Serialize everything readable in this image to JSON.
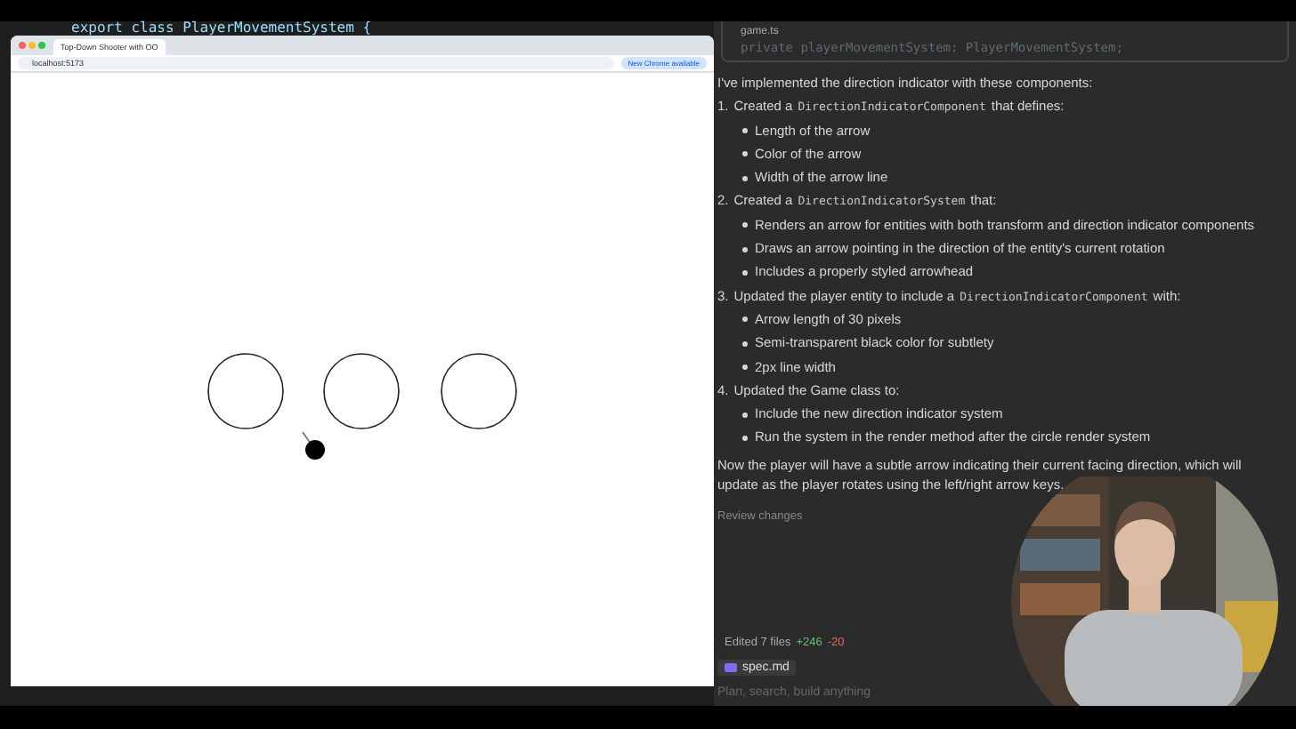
{
  "editor": {
    "code_line": "export class PlayerMovementSystem {"
  },
  "browser": {
    "tab_title": "Top-Down Shooter with OO",
    "address": "localhost:5173",
    "update_button": "New Chrome available",
    "scene": [
      {
        "kind": "ring"
      },
      {
        "kind": "ring"
      },
      {
        "kind": "ring"
      },
      {
        "kind": "player"
      }
    ]
  },
  "chat": {
    "file_tab": "game.ts",
    "code": "private playerMovementSystem: PlayerMovementSystem;",
    "intro": "I've implemented the direction indicator with these components:",
    "steps": [
      {
        "number": "1.",
        "text": {
          "before": "Created a",
          "code": "DirectionIndicatorComponent",
          "after": "that defines:"
        },
        "bullets": [
          "Length of the arrow",
          "Color of the arrow",
          "Width of the arrow line"
        ]
      },
      {
        "number": "2.",
        "text": {
          "before": "Created a",
          "code": "DirectionIndicatorSystem",
          "after": "that:"
        },
        "bullets": [
          "Renders an arrow for entities with both transform and direction indicator components",
          "Draws an arrow pointing in the direction of the entity's current rotation",
          "Includes a properly styled arrowhead"
        ]
      },
      {
        "number": "3.",
        "text": {
          "before": "Updated the player entity to include a",
          "code": "DirectionIndicatorComponent",
          "after": "with:"
        },
        "bullets": [
          "Arrow length of 30 pixels",
          "Semi-transparent black color for subtlety",
          "2px line width"
        ]
      },
      {
        "number": "4.",
        "text": {
          "before": "Updated the Game class to:"
        },
        "bullets": [
          "Include the new direction indicator system",
          "Run the system in the render method after the circle render system"
        ]
      }
    ],
    "summary": "Now the player will have a subtle arrow indicating their current facing direction, which will update as the player rotates using the left/right arrow keys.",
    "review": "Review changes",
    "edited": {
      "label": "Edited 7 files",
      "added": "+246",
      "removed": "-20"
    },
    "attachment": "spec.md",
    "input": {
      "placeholder": "Plan, search, build anything"
    }
  }
}
